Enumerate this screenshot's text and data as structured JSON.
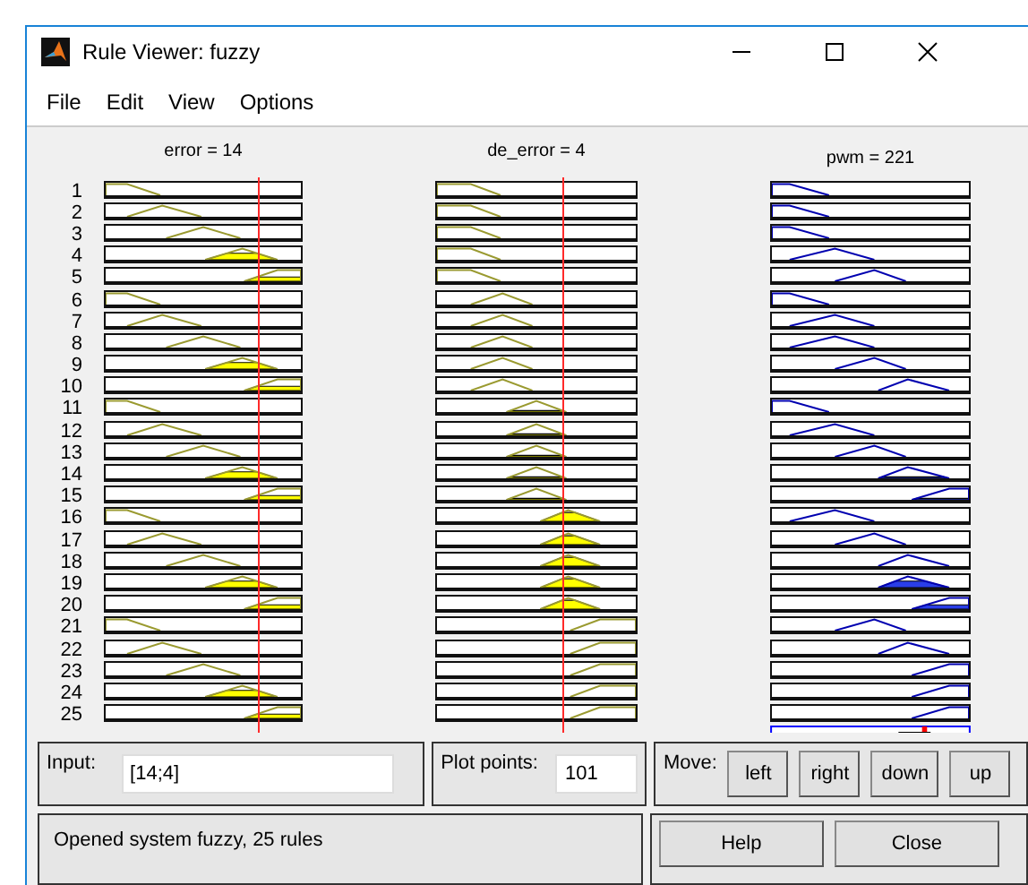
{
  "window": {
    "title": "Rule Viewer: fuzzy"
  },
  "menu": [
    "File",
    "Edit",
    "View",
    "Options"
  ],
  "variables": [
    {
      "label": "error = 14",
      "kind": "input",
      "level": 0.775
    },
    {
      "label": "de_error = 4",
      "kind": "input",
      "level": 0.63
    },
    {
      "label": "pwm = 221",
      "kind": "output",
      "level": 0.77
    }
  ],
  "rules": [
    {
      "number": "1",
      "cells": [
        {
          "kind": "nb"
        },
        {
          "kind": "nb"
        },
        {
          "kind": "nb"
        }
      ]
    },
    {
      "number": "2",
      "cells": [
        {
          "kind": "nm"
        },
        {
          "kind": "nb"
        },
        {
          "kind": "nb"
        }
      ]
    },
    {
      "number": "3",
      "cells": [
        {
          "kind": "z"
        },
        {
          "kind": "nb"
        },
        {
          "kind": "nb"
        }
      ]
    },
    {
      "number": "4",
      "cells": [
        {
          "kind": "pm"
        },
        {
          "kind": "nb"
        },
        {
          "kind": "nm"
        }
      ]
    },
    {
      "number": "5",
      "cells": [
        {
          "kind": "pb"
        },
        {
          "kind": "nb"
        },
        {
          "kind": "z"
        }
      ]
    },
    {
      "number": "6",
      "cells": [
        {
          "kind": "nb"
        },
        {
          "kind": "nm"
        },
        {
          "kind": "nb"
        }
      ]
    },
    {
      "number": "7",
      "cells": [
        {
          "kind": "nm"
        },
        {
          "kind": "nm"
        },
        {
          "kind": "nm"
        }
      ]
    },
    {
      "number": "8",
      "cells": [
        {
          "kind": "z"
        },
        {
          "kind": "nm"
        },
        {
          "kind": "nm"
        }
      ]
    },
    {
      "number": "9",
      "cells": [
        {
          "kind": "pm"
        },
        {
          "kind": "nm"
        },
        {
          "kind": "z"
        }
      ]
    },
    {
      "number": "10",
      "cells": [
        {
          "kind": "pb"
        },
        {
          "kind": "nm"
        },
        {
          "kind": "pm"
        }
      ]
    },
    {
      "number": "11",
      "cells": [
        {
          "kind": "nb"
        },
        {
          "kind": "z"
        },
        {
          "kind": "nb"
        }
      ]
    },
    {
      "number": "12",
      "cells": [
        {
          "kind": "nm"
        },
        {
          "kind": "z"
        },
        {
          "kind": "nm"
        }
      ]
    },
    {
      "number": "13",
      "cells": [
        {
          "kind": "z"
        },
        {
          "kind": "z"
        },
        {
          "kind": "z"
        }
      ]
    },
    {
      "number": "14",
      "cells": [
        {
          "kind": "pm"
        },
        {
          "kind": "z"
        },
        {
          "kind": "pm"
        }
      ]
    },
    {
      "number": "15",
      "cells": [
        {
          "kind": "pb"
        },
        {
          "kind": "z"
        },
        {
          "kind": "pb"
        }
      ]
    },
    {
      "number": "16",
      "cells": [
        {
          "kind": "nb"
        },
        {
          "kind": "pm"
        },
        {
          "kind": "nm"
        }
      ]
    },
    {
      "number": "17",
      "cells": [
        {
          "kind": "nm"
        },
        {
          "kind": "pm"
        },
        {
          "kind": "z"
        }
      ]
    },
    {
      "number": "18",
      "cells": [
        {
          "kind": "z"
        },
        {
          "kind": "pm"
        },
        {
          "kind": "pm"
        }
      ]
    },
    {
      "number": "19",
      "cells": [
        {
          "kind": "pm"
        },
        {
          "kind": "pm"
        },
        {
          "kind": "pm"
        }
      ]
    },
    {
      "number": "20",
      "cells": [
        {
          "kind": "pb"
        },
        {
          "kind": "pm"
        },
        {
          "kind": "pb"
        }
      ]
    },
    {
      "number": "21",
      "cells": [
        {
          "kind": "nb"
        },
        {
          "kind": "pb"
        },
        {
          "kind": "z"
        }
      ]
    },
    {
      "number": "22",
      "cells": [
        {
          "kind": "nm"
        },
        {
          "kind": "pb"
        },
        {
          "kind": "pm"
        }
      ]
    },
    {
      "number": "23",
      "cells": [
        {
          "kind": "z"
        },
        {
          "kind": "pb"
        },
        {
          "kind": "pb"
        }
      ]
    },
    {
      "number": "24",
      "cells": [
        {
          "kind": "pm"
        },
        {
          "kind": "pb"
        },
        {
          "kind": "pb"
        }
      ]
    },
    {
      "number": "25",
      "cells": [
        {
          "kind": "pb"
        },
        {
          "kind": "pb"
        },
        {
          "kind": "pb"
        }
      ]
    }
  ],
  "input_field": {
    "label": "Input:",
    "value": "[14;4]"
  },
  "plot_points": {
    "label": "Plot points:",
    "value": "101"
  },
  "move": {
    "label": "Move:",
    "buttons": [
      "left",
      "right",
      "down",
      "up"
    ]
  },
  "status": "Opened system fuzzy, 25 rules",
  "buttons": [
    "Help",
    "Close"
  ]
}
